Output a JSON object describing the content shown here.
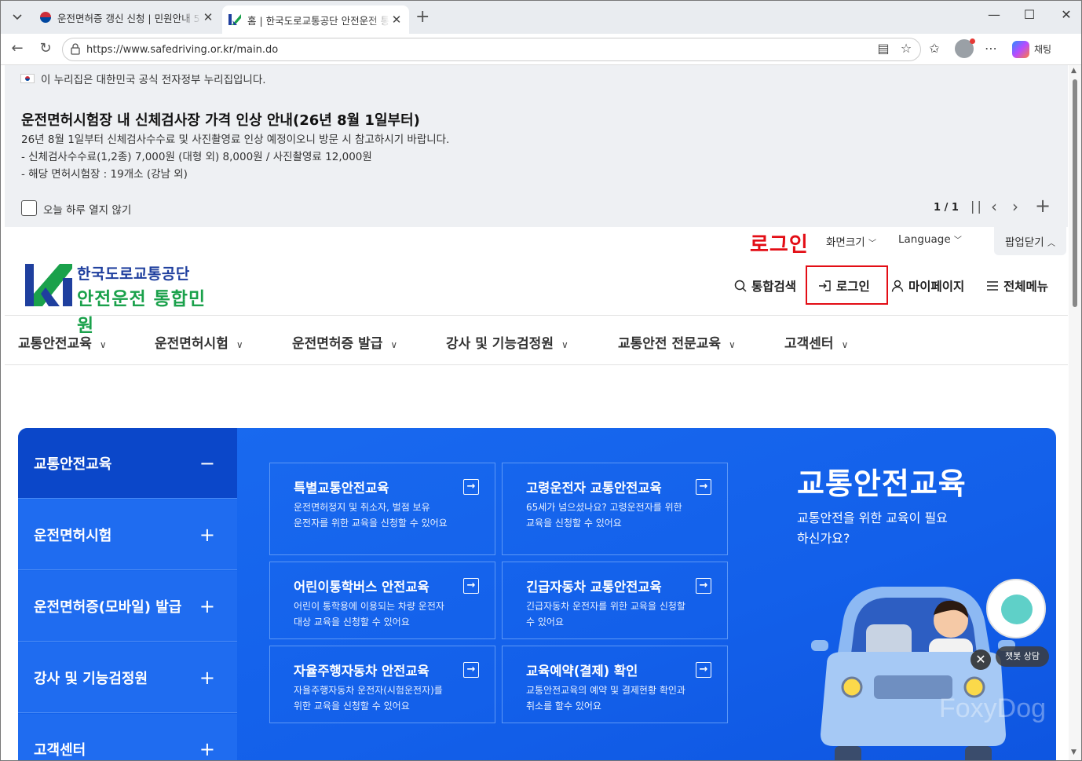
{
  "browser": {
    "tabs": [
      {
        "title": "운전면허증 갱신 신청 | 민원안내 5",
        "active": false
      },
      {
        "title": "홈 | 한국도로교통공단 안전운전 통",
        "active": true
      }
    ],
    "url": "https://www.safedriving.or.kr/main.do",
    "copilot_label": "채팅"
  },
  "gov_banner": {
    "text": "이 누리집은 대한민국 공식 전자정부 누리집입니다."
  },
  "popup": {
    "title": "운전면허시험장 내 신체검사장 가격 인상 안내(26년 8월 1일부터)",
    "lines": [
      "26년 8월 1일부터 신체검사수수료 및 사진촬영료 인상 예정이오니 방문 시 참고하시기 바랍니다.",
      "- 신체검사수수료(1,2종) 7,000원 (대형 외) 8,000원 / 사진촬영료 12,000원",
      "- 해당 면허시험장 : 19개소 (강남 외)"
    ],
    "checkbox_label": "오늘 하루 열지 않기",
    "pager": "1 / 1",
    "close_label": "팝업닫기"
  },
  "annotation": {
    "text": "로그인",
    "color": "#e30d15"
  },
  "util": {
    "font_size": "화면크기",
    "language": "Language"
  },
  "logo": {
    "line1": "한국도로교통공단",
    "line2": "안전운전 통합민원"
  },
  "header_nav": [
    {
      "label": "통합검색",
      "icon": "search-icon"
    },
    {
      "label": "로그인",
      "icon": "login-icon"
    },
    {
      "label": "마이페이지",
      "icon": "user-icon"
    },
    {
      "label": "전체메뉴",
      "icon": "menu-icon"
    }
  ],
  "gnb": [
    "교통안전교육",
    "운전면허시험",
    "운전면허증 발급",
    "강사 및 기능검정원",
    "교통안전 전문교육",
    "고객센터"
  ],
  "sidebar": [
    {
      "label": "교통안전교육",
      "state": "−",
      "active": true
    },
    {
      "label": "운전면허시험",
      "state": "+"
    },
    {
      "label": "운전면허증(모바일) 발급",
      "state": "+"
    },
    {
      "label": "강사 및 기능검정원",
      "state": "+"
    },
    {
      "label": "고객센터",
      "state": "+"
    }
  ],
  "cards": [
    {
      "title": "특별교통안전교육",
      "desc": [
        "운전면허정지 및 취소자, 벌점 보유",
        "운전자를 위한 교육을 신청할 수 있어요"
      ]
    },
    {
      "title": "고령운전자 교통안전교육",
      "desc": [
        "65세가 넘으셨나요? 고령운전자를 위한",
        "교육을 신청할 수 있어요"
      ]
    },
    {
      "title": "어린이통학버스 안전교육",
      "desc": [
        "어린이 통학용에 이용되는 차량 운전자",
        "대상 교육을 신청할 수 있어요"
      ]
    },
    {
      "title": "긴급자동차 교통안전교육",
      "desc": [
        "긴급자동차 운전자를 위한 교육을 신청할",
        "수 있어요"
      ]
    },
    {
      "title": "자율주행자동차 안전교육",
      "desc": [
        "자율주행자동차 운전자(시험운전자)를",
        "위한 교육을 신청할 수 있어요"
      ]
    },
    {
      "title": "교육예약(결제) 확인",
      "desc": [
        "교통안전교육의 예약 및 결제현황 확인과",
        "취소를 할수 있어요"
      ]
    }
  ],
  "promo": {
    "heading": "교통안전교육",
    "sub": "교통안전을 위한 교육이 필요하신가요?"
  },
  "chatbot": {
    "label": "챗봇 상담"
  },
  "watermark": "FoxyDog",
  "colors": {
    "brand_blue": "#1360ea",
    "active_side": "#0b47c9",
    "logo_navy": "#1f3f9e",
    "logo_green": "#1aa14b"
  }
}
